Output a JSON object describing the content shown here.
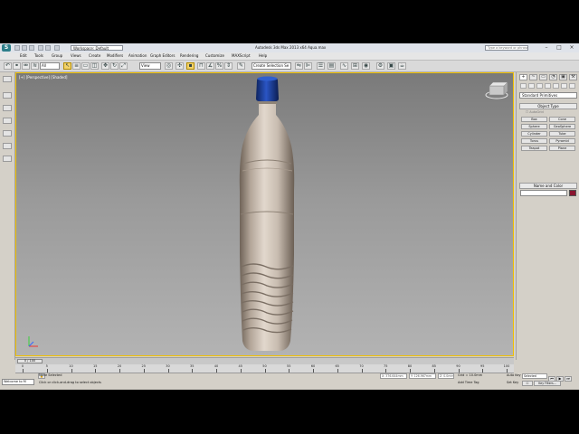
{
  "title_bar": {
    "workspace": "Workspace: Default",
    "window_title": "Autodesk 3ds Max 2013 x64    Aqua.max",
    "search_placeholder": "Type a keyword or phrase"
  },
  "menu": [
    "Edit",
    "Tools",
    "Group",
    "Views",
    "Create",
    "Modifiers",
    "Animation",
    "Graph Editors",
    "Rendering",
    "Customize",
    "MAXScript",
    "Help"
  ],
  "toolbar": {
    "selection_filter": "All",
    "reference_coord": "View",
    "named_selection": "Create Selection Se"
  },
  "viewport": {
    "label": "[+] [Perspective] [Shaded]"
  },
  "command_panel": {
    "tabs": [
      "+",
      "~",
      "▭",
      "◔",
      "▣",
      "⚒"
    ],
    "category": "Standard Primitives",
    "object_type_rollout": "Object Type",
    "autogrid_label": "AutoGrid",
    "primitives": [
      "Box",
      "Cone",
      "Sphere",
      "GeoSphere",
      "Cylinder",
      "Tube",
      "Torus",
      "Pyramid",
      "Teapot",
      "Plane"
    ],
    "name_color_rollout": "Name and Color",
    "object_color": "#8a1530"
  },
  "time_slider": {
    "frame_label": "0 / 100",
    "progress": 0.0
  },
  "track_bar": {
    "ticks": [
      "0",
      "5",
      "10",
      "15",
      "20",
      "25",
      "30",
      "35",
      "40",
      "45",
      "50",
      "55",
      "60",
      "65",
      "70",
      "75",
      "80",
      "85",
      "90",
      "95",
      "100"
    ]
  },
  "status_bar": {
    "maxscript_text": "Welcome to M",
    "selection_status": "None Selected",
    "prompt": "Click or click-and-drag to select objects",
    "x": "X: 376.644mm",
    "y": "Y: 126.967mm",
    "z": "Z: 0.0mm",
    "grid": "Grid = 10.0mm",
    "add_time_tag": "Add Time Tag",
    "auto_key_label": "Auto Key",
    "auto_key_value": "Selected",
    "set_key_label": "Set Key",
    "key_filters": "Key Filters..."
  },
  "colors": {
    "bottle_cap": "#1e3f96",
    "bottle_body": "#d9cfc4",
    "viewport_border": "#f0c000"
  }
}
